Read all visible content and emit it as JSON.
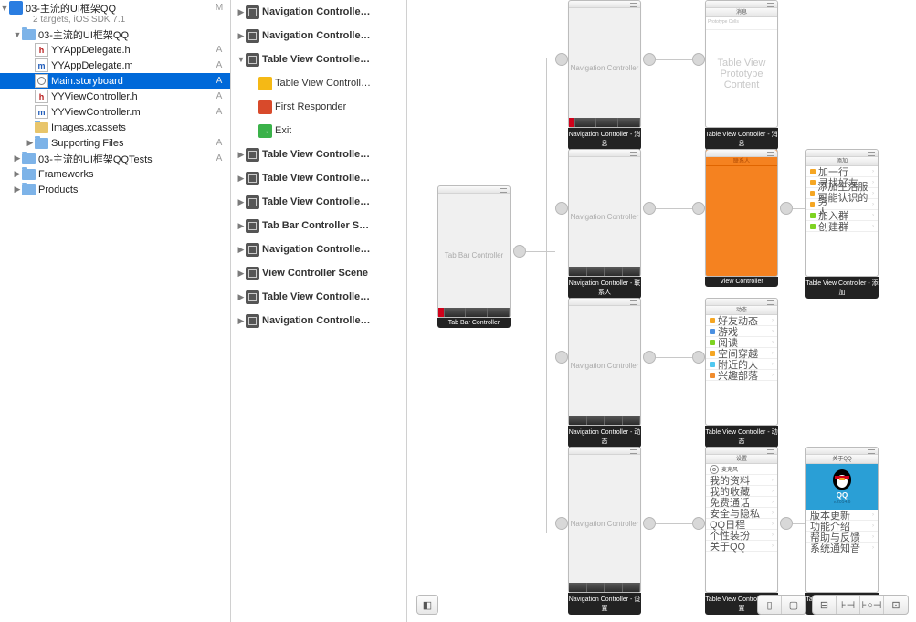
{
  "nav": {
    "project": "03-主流的UI框架QQ",
    "subtitle": "2 targets, iOS SDK 7.1",
    "scm_m": "M",
    "scm_a": "A",
    "groups": {
      "main": "03-主流的UI框架QQ",
      "tests": "03-主流的UI框架QQTests",
      "frameworks": "Frameworks",
      "products": "Products",
      "images": "Images.xcassets",
      "supporting": "Supporting Files"
    },
    "files": {
      "appdel_h": "YYAppDelegate.h",
      "appdel_m": "YYAppDelegate.m",
      "main_sb": "Main.storyboard",
      "vc_h": "YYViewController.h",
      "vc_m": "YYViewController.m"
    }
  },
  "outline": {
    "items": [
      {
        "t": "scene",
        "l": "Navigation Controlle…",
        "exp": false
      },
      {
        "t": "scene",
        "l": "Navigation Controlle…",
        "exp": false
      },
      {
        "t": "scene",
        "l": "Table View Controlle…",
        "exp": true,
        "children": [
          {
            "t": "cube",
            "l": "Table View Controll…"
          },
          {
            "t": "fr",
            "l": "First Responder"
          },
          {
            "t": "exit",
            "l": "Exit"
          }
        ]
      },
      {
        "t": "scene",
        "l": "Table View Controlle…",
        "exp": false
      },
      {
        "t": "scene",
        "l": "Table View Controlle…",
        "exp": false
      },
      {
        "t": "scene",
        "l": "Table View Controlle…",
        "exp": false
      },
      {
        "t": "scene",
        "l": "Tab Bar Controller S…",
        "exp": false
      },
      {
        "t": "scene",
        "l": "Navigation Controlle…",
        "exp": false
      },
      {
        "t": "scene",
        "l": "View Controller Scene",
        "exp": false
      },
      {
        "t": "scene",
        "l": "Table View Controlle…",
        "exp": false
      },
      {
        "t": "scene",
        "l": "Navigation Controlle…",
        "exp": false
      }
    ]
  },
  "canvas": {
    "tabbar": {
      "title": "Tab Bar Controller",
      "label": "Tab Bar Controller"
    },
    "nav1": {
      "title": "Navigation Controller",
      "label": "Navigation Controller - 消息"
    },
    "nav2": {
      "title": "Navigation Controller",
      "label": "Navigation Controller - 联系人"
    },
    "nav3": {
      "title": "Navigation Controller",
      "label": "Navigation Controller - 动态"
    },
    "nav4": {
      "title": "Navigation Controller",
      "label": "Navigation Controller - 设置"
    },
    "tvc1": {
      "hdr": "消息",
      "note": "Table View",
      "note2": "Prototype Content",
      "label": "Table View Controller - 消息"
    },
    "vc2": {
      "label": "View Controller"
    },
    "tvc2b": {
      "hdr": "添加",
      "label": "Table View Controller - 添加",
      "cells": [
        "加一行",
        "寻找好友",
        "添加生活服务",
        "可能认识的人",
        "加入群",
        "创建群"
      ]
    },
    "tvc3": {
      "hdr": "动态",
      "label": "Table View Controller - 动态",
      "cells": [
        "好友动态",
        "游戏",
        "阅读",
        "空间穿越",
        "附近的人",
        "兴趣部落"
      ]
    },
    "tvc4": {
      "hdr": "设置",
      "label": "Table View Controller - 设置",
      "cells": [
        "我的资料",
        "我的收藏",
        "免费通话",
        "安全与隐私",
        "QQ日程",
        "个性装扮",
        "关于QQ"
      ]
    },
    "tvc4b": {
      "hdr": "关于QQ",
      "ver": "v.2014.6",
      "label": "Table View Controller - 关于QQ",
      "cells": [
        "版本更新",
        "功能介绍",
        "帮助与反馈",
        "系统通知音"
      ]
    }
  },
  "colors": {
    "orange": "#f58220",
    "blue": "#2a9fd6"
  }
}
